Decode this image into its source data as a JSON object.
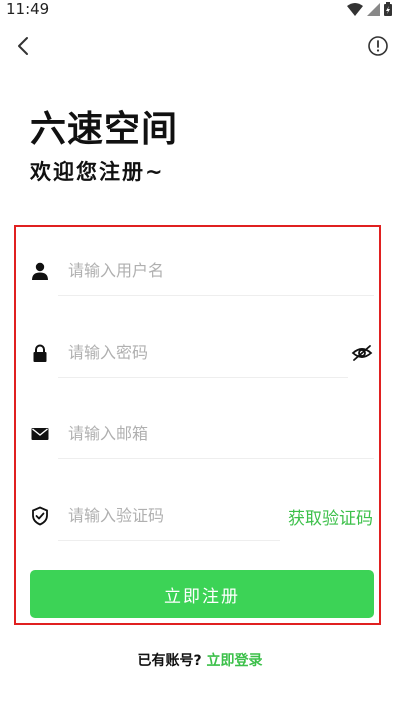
{
  "status_bar": {
    "time": "11:49"
  },
  "nav": {
    "back_icon": "chevron-left-icon",
    "info_icon": "info-circle-icon"
  },
  "header": {
    "title": "六速空间",
    "subtitle": "欢迎您注册~"
  },
  "form": {
    "username": {
      "placeholder": "请输入用户名",
      "value": "",
      "icon": "user-icon"
    },
    "password": {
      "placeholder": "请输入密码",
      "value": "",
      "icon": "lock-icon",
      "toggle_icon": "eye-off-icon"
    },
    "email": {
      "placeholder": "请输入邮箱",
      "value": "",
      "icon": "mail-icon"
    },
    "code": {
      "placeholder": "请输入验证码",
      "value": "",
      "icon": "shield-check-icon",
      "get_code_label": "获取验证码"
    },
    "submit_label": "立即注册"
  },
  "footer": {
    "prompt": "已有账号?",
    "login_label": "立即登录"
  },
  "colors": {
    "accent": "#3cd356",
    "link": "#3cc04a",
    "highlight_border": "#e02020"
  }
}
